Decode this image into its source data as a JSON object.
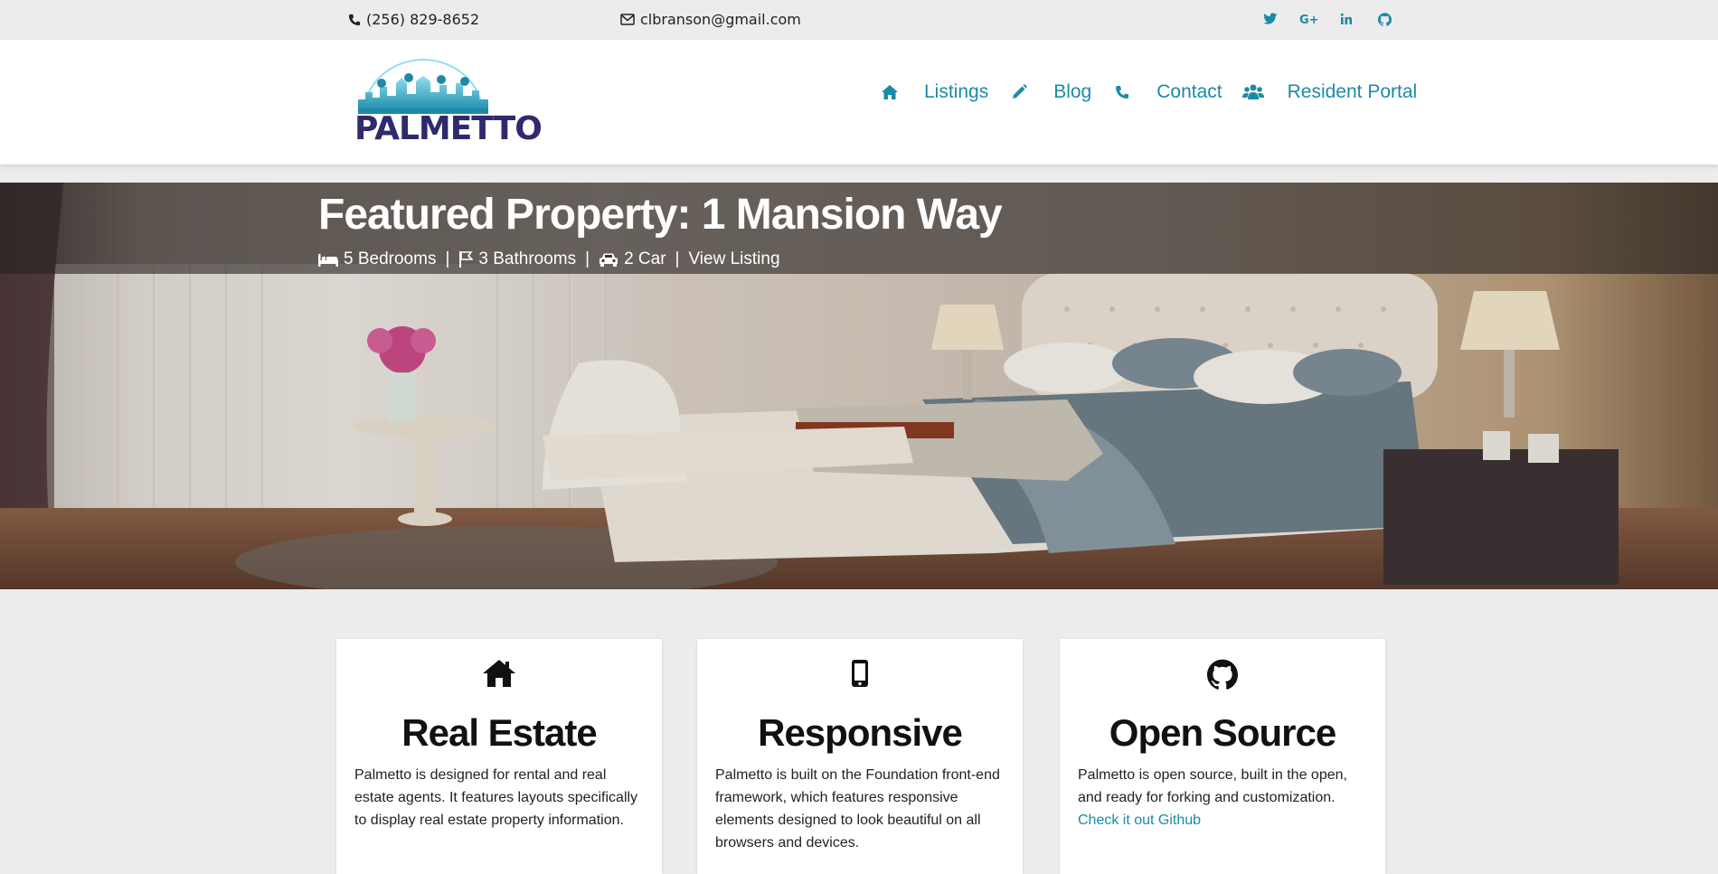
{
  "topbar": {
    "phone": "(256) 829-8652",
    "email": "clbranson@gmail.com",
    "social": [
      "twitter-icon",
      "google-plus-icon",
      "linkedin-icon",
      "github-icon"
    ]
  },
  "header": {
    "logo_text": "PALMETTO",
    "nav": [
      {
        "label": "Listings",
        "icon": "home-icon"
      },
      {
        "label": "Blog",
        "icon": "pencil-icon"
      },
      {
        "label": "Contact",
        "icon": "phone-icon"
      },
      {
        "label": "Resident Portal",
        "icon": "users-icon"
      }
    ]
  },
  "hero": {
    "title": "Featured Property: 1 Mansion Way",
    "bedrooms": "5 Bedrooms",
    "bathrooms": "3 Bathrooms",
    "car": "2 Car",
    "link": "View Listing",
    "separator": "|"
  },
  "cards": [
    {
      "title": "Real Estate",
      "icon": "home-icon",
      "body": "Palmetto is designed for rental and real estate agents. It features layouts specifically to display real estate property information."
    },
    {
      "title": "Responsive",
      "icon": "mobile-icon",
      "body": "Palmetto is built on the Foundation front-end framework, which features responsive elements designed to look beautiful on all browsers and devices."
    },
    {
      "title": "Open Source",
      "icon": "github-icon",
      "body": "Palmetto is open source, built in the open, and ready for forking and customization.",
      "link": "Check it out Github"
    }
  ],
  "colors": {
    "accent": "#1b8aa8",
    "logo_dark": "#2f2a6e",
    "background": "#ececec"
  }
}
